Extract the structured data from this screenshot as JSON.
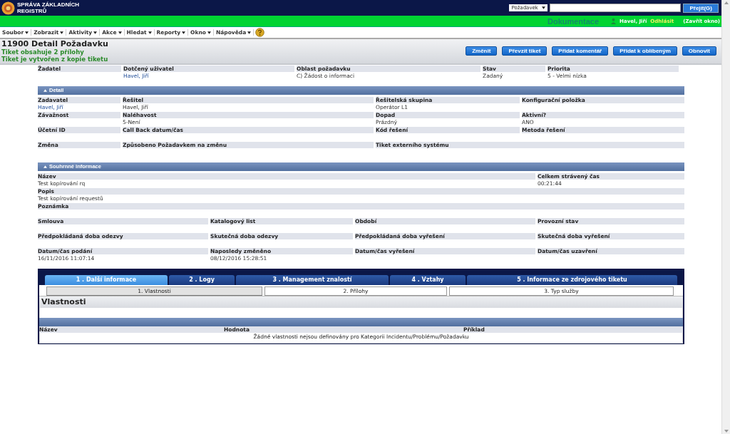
{
  "header": {
    "logo_text": "SPRÁVA ZÁKLADNÍCH REGISTRŮ",
    "search_type": "Požadavek",
    "go_button": "Přejít(G)"
  },
  "userbar": {
    "documentation": "Dokumentace",
    "user": "Havel, Jiří",
    "logout": "Odhlásit",
    "close_window": "(Zavřít okno)"
  },
  "menu": [
    {
      "label": "Soubor"
    },
    {
      "label": "Zobrazit"
    },
    {
      "label": "Aktivity"
    },
    {
      "label": "Akce"
    },
    {
      "label": "Hledat"
    },
    {
      "label": "Reporty"
    },
    {
      "label": "Okno"
    },
    {
      "label": "Nápověda"
    }
  ],
  "page_title": "11900 Detail Požadavku",
  "notices": [
    "Tiket obsahuje 2 přílohy",
    "Tiket je vytvořen z kopie tiketu"
  ],
  "actions": [
    "Změnit",
    "Převzít tiket",
    "Přidat komentář",
    "Přidat k oblíbeným",
    "Obnovit"
  ],
  "sections": [
    {
      "rows": [
        {
          "cells": [
            {
              "label": "Žadatel"
            },
            {
              "label": "Dotčený uživatel",
              "value": "Havel, Jiří",
              "link": true
            },
            {
              "label": "Oblast požadavku",
              "value": "C) Žádost o informaci",
              "link": false
            },
            {
              "label": "Stav",
              "value": "Zadaný",
              "link": false
            },
            {
              "label": "Priorita",
              "value": "5 - Velmi nízka",
              "link": false
            }
          ]
        }
      ]
    },
    {
      "title": "Detail",
      "expanded": true,
      "rows": [
        {
          "cells": [
            {
              "label": "Zadavatel",
              "value": "Havel, Jiří",
              "link": true
            },
            {
              "label": "Řešitel",
              "value": "Havel, Jiří",
              "link": false
            },
            {
              "label": "Řešitelská skupina",
              "value": "Operátor L1",
              "link": false
            },
            {
              "label": "Konfigurační položka"
            }
          ]
        },
        {
          "cells": [
            {
              "label": "Závažnost"
            },
            {
              "label": "Naléhavost",
              "value": "5-Není",
              "link": false
            },
            {
              "label": "Dopad",
              "value": "Prázdný",
              "link": false
            },
            {
              "label": "Aktivní?",
              "value": "ANO",
              "link": false
            }
          ]
        },
        {
          "cells": [
            {
              "label": "Účetní ID"
            },
            {
              "label": "Call Back datum/čas"
            },
            {
              "label": "Kód řešení"
            },
            {
              "label": "Metoda řešení"
            }
          ]
        },
        {
          "cells": [
            {
              "label": "Změna"
            },
            {
              "label": "Způsobeno Požadavkem na změnu"
            },
            {
              "label": "Tiket externího systému",
              "colspan": 2
            }
          ]
        }
      ]
    },
    {
      "title": "Souhrnné informace",
      "expanded": true,
      "rows": [
        {
          "cells": [
            {
              "label": "Název",
              "value": "Test kopírování rq",
              "link": false,
              "colspan": 3
            },
            {
              "label": "Celkem strávený čas",
              "value": "00:21:44",
              "link": false
            }
          ]
        },
        {
          "cells": [
            {
              "label": "Popis",
              "value": "Test kopírování requestů",
              "link": false,
              "colspan": 4
            }
          ]
        },
        {
          "cells": [
            {
              "label": "Poznámka",
              "colspan": 4
            }
          ]
        },
        {
          "cells": [
            {
              "label": "Smlouva"
            },
            {
              "label": "Katalogový list"
            },
            {
              "label": "Období"
            },
            {
              "label": "Provozní stav"
            }
          ]
        },
        {
          "cells": [
            {
              "label": "Předpokládaná doba odezvy"
            },
            {
              "label": "Skutečná doba odezvy"
            },
            {
              "label": "Předpokládaná doba vyřešení"
            },
            {
              "label": "Skutečná doba vyřešení"
            }
          ]
        },
        {
          "cells": [
            {
              "label": "Datum/čas podání",
              "value": "16/11/2016 11:07:14",
              "link": false
            },
            {
              "label": "Naposledy změněno",
              "value": "08/12/2016 15:28:51",
              "link": false
            },
            {
              "label": "Datum/čas vyřešení"
            },
            {
              "label": "Datum/čas uzavření"
            }
          ]
        }
      ]
    }
  ],
  "tabs": [
    {
      "label": "1 . Další informace",
      "selected": true
    },
    {
      "label": "2 . Logy",
      "selected": false
    },
    {
      "label": "3 . Management znalostí",
      "selected": false
    },
    {
      "label": "4 . Vztahy",
      "selected": false
    },
    {
      "label": "5 . Informace ze zdrojového tiketu",
      "selected": false
    }
  ],
  "subtabs": [
    {
      "label": "1. Vlastnosti",
      "selected": true
    },
    {
      "label": "2. Přílohy",
      "selected": false
    },
    {
      "label": "3. Typ služby",
      "selected": false
    }
  ],
  "panel": {
    "title": "Vlastnosti",
    "columns": [
      "Název",
      "Hodnota",
      "Příklad"
    ],
    "empty_message": "Žádné vlastnosti nejsou definovány pro Kategorii Incidentu/Problému/Požadavku"
  }
}
